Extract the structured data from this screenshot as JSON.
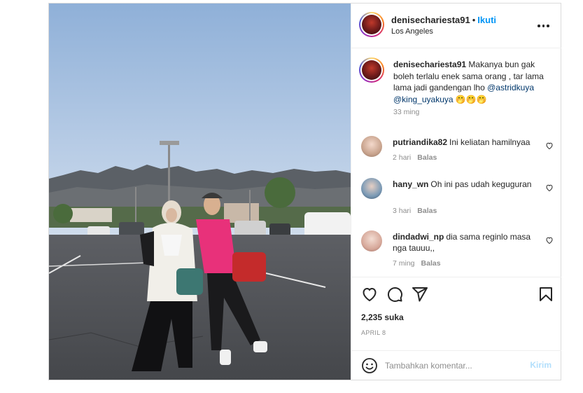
{
  "post": {
    "username": "denisechariesta91",
    "separator": "•",
    "follow_label": "Ikuti",
    "location": "Los Angeles",
    "caption": {
      "username": "denisechariesta91",
      "text": "Makanya bun gak boleh terlalu enek sama orang , tar lama lama jadi gandengan lho",
      "mention_1": "@astridkuya",
      "mention_2": "@king_uyakuya",
      "emoji": "🤭🤭🤭",
      "time": "33 ming"
    },
    "comments": [
      {
        "username": "putriandika82",
        "text": "Ini keliatan hamilnyaa",
        "time": "2 hari",
        "reply_label": "Balas"
      },
      {
        "username": "hany_wn",
        "text": "Oh ini pas udah keguguran",
        "time": "3 hari",
        "reply_label": "Balas"
      },
      {
        "username": "dindadwi_np",
        "text": "dia sama reginlo masa nga tauuu,,",
        "time": "7 ming",
        "reply_label": "Balas"
      }
    ],
    "likes": "2,235 suka",
    "date": "APRIL 8",
    "comment_placeholder": "Tambahkan komentar...",
    "post_button": "Kirim"
  },
  "icons": {
    "more": "more-options-icon",
    "like": "heart-icon",
    "comment": "comment-icon",
    "share": "send-icon",
    "save": "bookmark-icon",
    "emoji": "emoji-icon"
  },
  "colors": {
    "follow": "#0095f6",
    "post_disabled": "#b2dffc",
    "secondary_text": "#8e8e8e",
    "mention": "#00376b"
  }
}
